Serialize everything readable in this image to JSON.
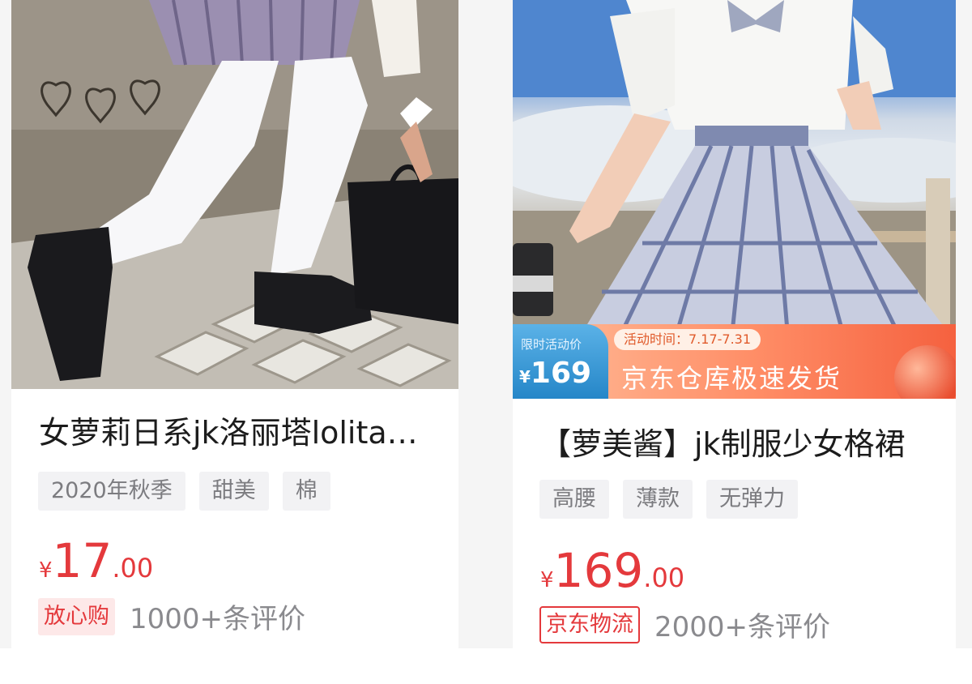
{
  "products": [
    {
      "title": "女萝莉日系jk洛丽塔lolita白丝袜",
      "tags": [
        "2020年秋季",
        "甜美",
        "棉"
      ],
      "price": {
        "currency": "¥",
        "integer": "17",
        "decimal": ".00"
      },
      "badge": "放心购",
      "reviews": "1000+条评价"
    },
    {
      "title": "【萝美酱】jk制服少女格裙",
      "tags": [
        "高腰",
        "薄款",
        "无弹力"
      ],
      "price": {
        "currency": "¥",
        "integer": "169",
        "decimal": ".00"
      },
      "badge": "京东物流",
      "reviews": "2000+条评价",
      "promo": {
        "label": "限时活动价",
        "currency": "¥",
        "price": "169",
        "time": "活动时间：7.17-7.31",
        "slogan": "京东仓库极速发货"
      }
    }
  ],
  "colors": {
    "accent": "#e4393c",
    "tag_bg": "#f2f2f4",
    "page_bg": "#f5f5f5"
  }
}
